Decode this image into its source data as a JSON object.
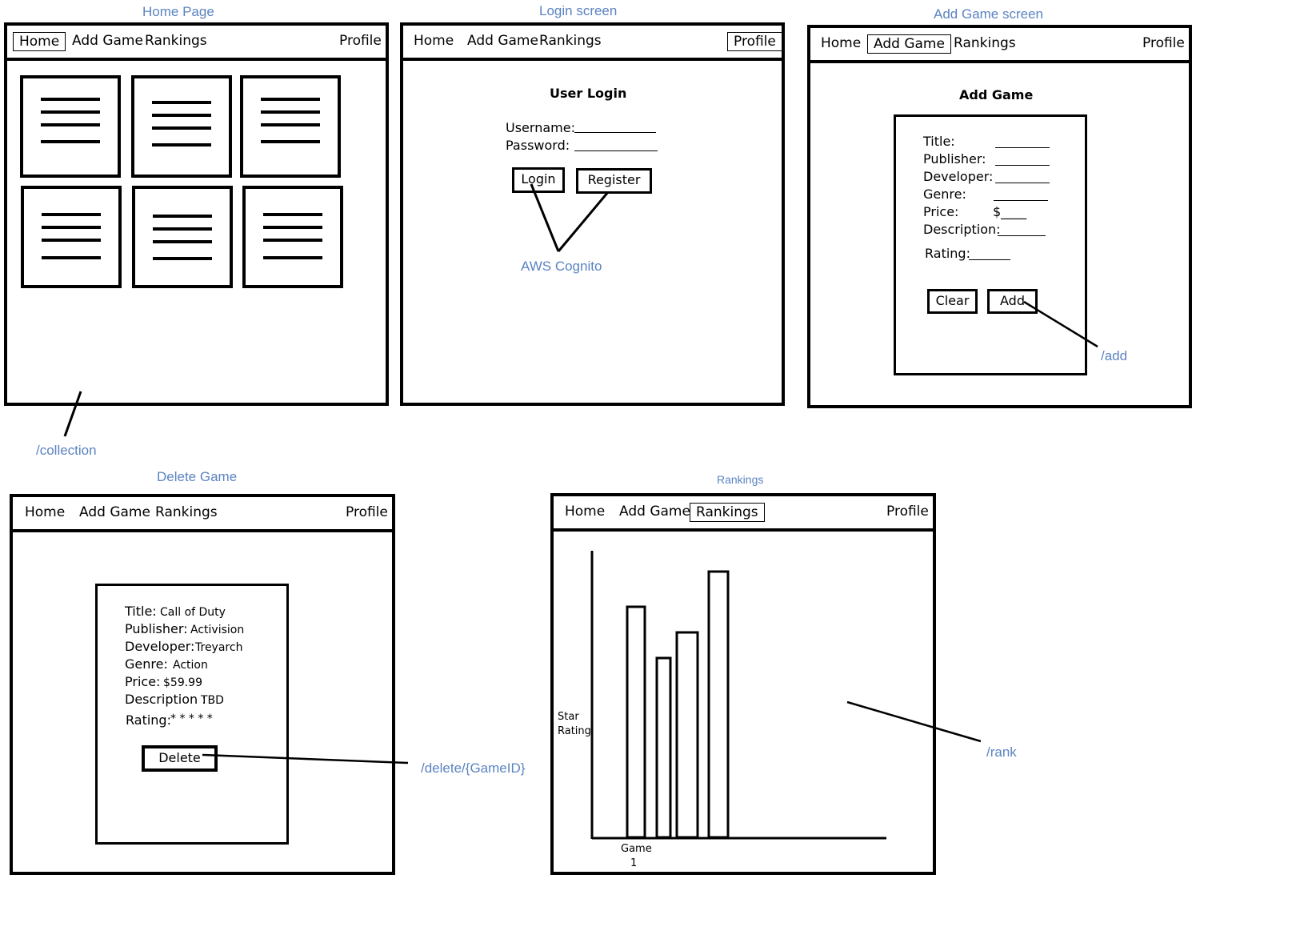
{
  "nav": {
    "home": "Home",
    "add_game": "Add Game",
    "rankings": "Rankings",
    "profile": "Profile"
  },
  "home_page": {
    "caption": "Home Page",
    "route": "/collection"
  },
  "login_screen": {
    "caption": "Login screen",
    "heading": "User Login",
    "username_label": "Username:",
    "password_label": "Password:",
    "login_button": "Login",
    "register_button": "Register",
    "auth_note": "AWS Cognito"
  },
  "add_game_screen": {
    "caption": "Add Game screen",
    "heading": "Add Game",
    "fields": {
      "title": "Title:",
      "publisher": "Publisher:",
      "developer": "Developer:",
      "genre": "Genre:",
      "price": "Price:",
      "price_prefix": "$____",
      "description": "Description:",
      "rating": "Rating:"
    },
    "clear_button": "Clear",
    "add_button": "Add",
    "route": "/add"
  },
  "delete_game": {
    "caption": "Delete Game",
    "details": [
      {
        "label": "Title:",
        "value": "Call of Duty"
      },
      {
        "label": "Publisher:",
        "value": "Activision"
      },
      {
        "label": "Developer:",
        "value": "Treyarch"
      },
      {
        "label": "Genre:",
        "value": "Action"
      },
      {
        "label": "Price:",
        "value": "$59.99"
      },
      {
        "label": "Description :",
        "value": "TBD"
      },
      {
        "label": "Rating:",
        "value": "* * * * *"
      }
    ],
    "delete_button": "Delete",
    "route": "/delete/{GameID}"
  },
  "rankings_screen": {
    "caption": "Rankings",
    "route": "/rank",
    "y_axis_label_line1": "Star",
    "y_axis_label_line2": "Rating",
    "x_axis_label_line1": "Game",
    "x_axis_label_line2": "1"
  },
  "chart_data": {
    "type": "bar",
    "categories": [
      "",
      "",
      "",
      ""
    ],
    "values": [
      0.72,
      0.56,
      0.64,
      0.83
    ],
    "ylim": [
      0,
      1
    ],
    "grid": false,
    "legend": "none"
  }
}
